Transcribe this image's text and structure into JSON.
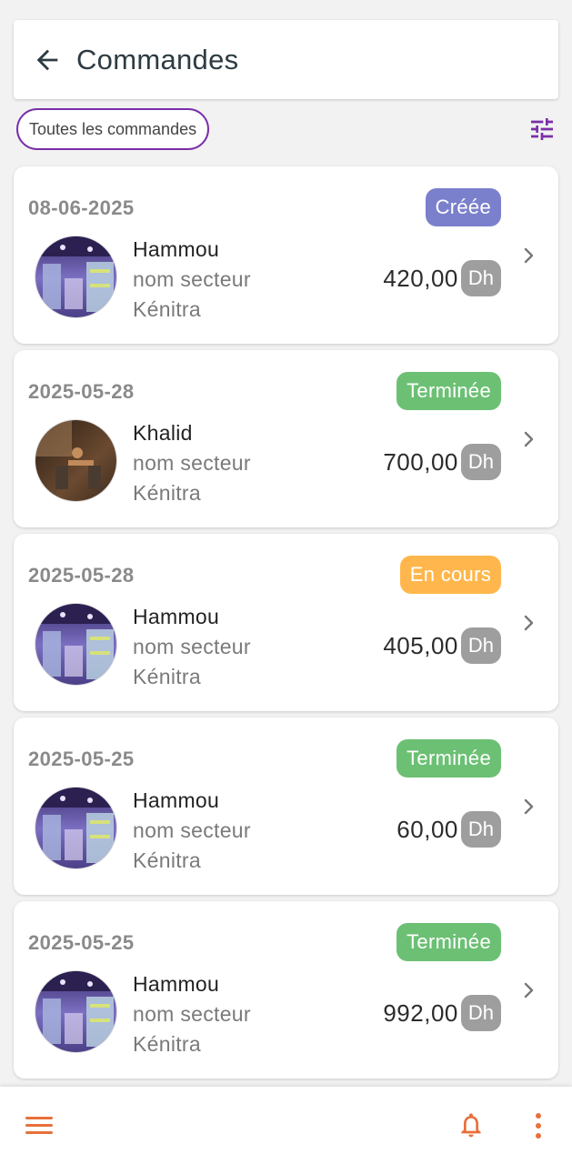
{
  "header": {
    "title": "Commandes",
    "back_icon": "arrow-left-icon"
  },
  "filter": {
    "chip_label": "Toutes les commandes",
    "chip_color": "#7a2fa8",
    "tune_icon": "tune-sliders-icon",
    "tune_color": "#7a2fa8"
  },
  "orders": [
    {
      "date": "08-06-2025",
      "status": "Créée",
      "status_color": "#7b80cc",
      "client": "Hammou",
      "sector": "nom secteur",
      "city": "Kénitra",
      "amount": "420,00",
      "currency": "Dh",
      "avatar": "shop-interior-photo"
    },
    {
      "date": "2025-05-28",
      "status": "Terminée",
      "status_color": "#6cc074",
      "client": "Khalid",
      "sector": "nom secteur",
      "city": "Kénitra",
      "amount": "700,00",
      "currency": "Dh",
      "avatar": "cafe-interior-photo"
    },
    {
      "date": "2025-05-28",
      "status": "En cours",
      "status_color": "#ffb74d",
      "client": "Hammou",
      "sector": "nom secteur",
      "city": "Kénitra",
      "amount": "405,00",
      "currency": "Dh",
      "avatar": "shop-interior-photo"
    },
    {
      "date": "2025-05-25",
      "status": "Terminée",
      "status_color": "#6cc074",
      "client": "Hammou",
      "sector": "nom secteur",
      "city": "Kénitra",
      "amount": "60,00",
      "currency": "Dh",
      "avatar": "shop-interior-photo"
    },
    {
      "date": "2025-05-25",
      "status": "Terminée",
      "status_color": "#6cc074",
      "client": "Hammou",
      "sector": "nom secteur",
      "city": "Kénitra",
      "amount": "992,00",
      "currency": "Dh",
      "avatar": "shop-interior-photo"
    }
  ],
  "bottom_bar": {
    "menu_icon": "hamburger-menu-icon",
    "bell_icon": "bell-icon",
    "more_icon": "more-vertical-icon",
    "accent_color": "#e8703a"
  }
}
